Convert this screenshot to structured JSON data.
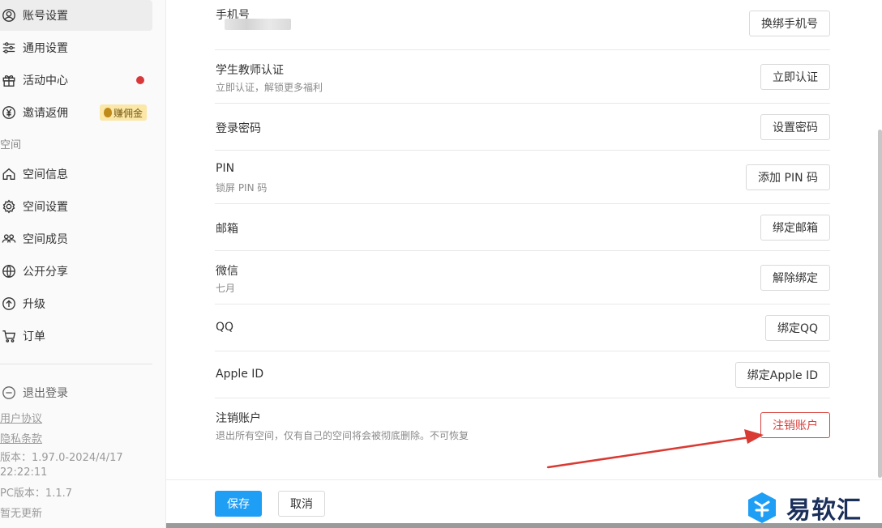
{
  "sidebar": {
    "items": [
      {
        "label": "账号设置",
        "icon": "user-circle-icon",
        "active": true
      },
      {
        "label": "通用设置",
        "icon": "sliders-icon"
      },
      {
        "label": "活动中心",
        "icon": "gift-icon"
      },
      {
        "label": "邀请返佣",
        "icon": "yen-icon"
      }
    ],
    "badge_label": "赚佣金",
    "section_label": "空间",
    "space_items": [
      {
        "label": "空间信息",
        "icon": "home-icon"
      },
      {
        "label": "空间设置",
        "icon": "gear-icon"
      },
      {
        "label": "空间成员",
        "icon": "members-icon"
      },
      {
        "label": "公开分享",
        "icon": "globe-icon"
      },
      {
        "label": "升级",
        "icon": "arrow-up-circle-icon"
      },
      {
        "label": "订单",
        "icon": "cart-icon"
      }
    ],
    "logout_label": "退出登录",
    "user_agreement": "用户协议",
    "privacy_policy": "隐私条款",
    "version_line1": "版本：1.97.0-2024/4/17",
    "version_line2": "22:22:11",
    "pc_version": "PC版本：1.1.7",
    "no_update": "暂无更新"
  },
  "settings": {
    "rows": [
      {
        "title": "手机号",
        "sub": "",
        "button": "换绑手机号"
      },
      {
        "title": "学生教师认证",
        "sub": "立即认证，解锁更多福利",
        "button": "立即认证"
      },
      {
        "title": "登录密码",
        "sub": "",
        "button": "设置密码"
      },
      {
        "title": "PIN",
        "sub": "锁屏 PIN 码",
        "button": "添加 PIN 码"
      },
      {
        "title": "邮箱",
        "sub": "",
        "button": "绑定邮箱"
      },
      {
        "title": "微信",
        "sub": "七月",
        "button": "解除绑定"
      },
      {
        "title": "QQ",
        "sub": "",
        "button": "绑定QQ"
      },
      {
        "title": "Apple ID",
        "sub": "",
        "button": "绑定Apple ID"
      },
      {
        "title": "注销账户",
        "sub": "退出所有空间，仅有自己的空间将会被彻底删除。不可恢复",
        "button": "注销账户"
      }
    ]
  },
  "footer": {
    "save_label": "保存",
    "cancel_label": "取消"
  },
  "watermark": {
    "text": "易软汇"
  },
  "colors": {
    "accent": "#1e9ef5",
    "danger": "#d9423d",
    "badge_bg": "#fbe7a8",
    "dot": "#d9383a",
    "arrow": "#d93a33"
  }
}
